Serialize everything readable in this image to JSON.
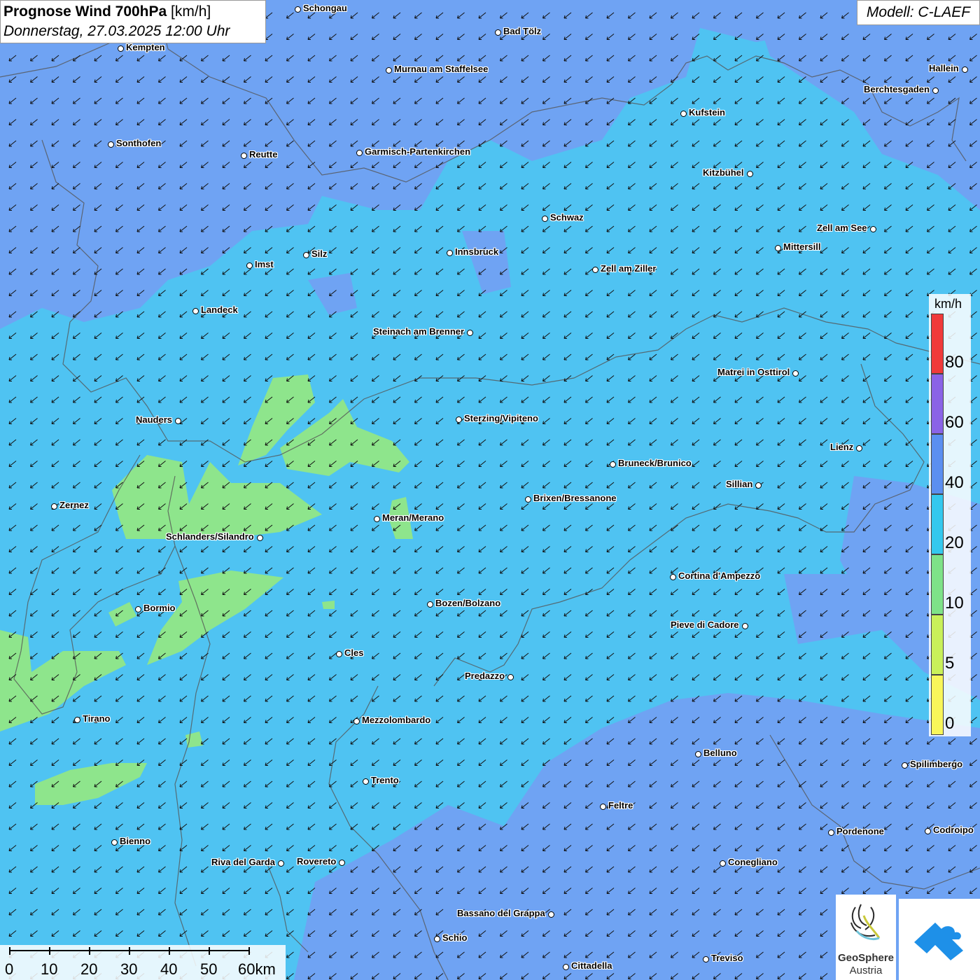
{
  "map": {
    "title_bold": "Prognose Wind 700hPa",
    "title_unit": "[km/h]",
    "subtitle": "Donnerstag, 27.03.2025 12:00 Uhr",
    "model": "Modell: C-LAEF"
  },
  "legend": {
    "unit": "km/h",
    "bins": [
      {
        "from": 0,
        "to": 5,
        "color": "#f8f65a"
      },
      {
        "from": 5,
        "to": 10,
        "color": "#c9f05a"
      },
      {
        "from": 10,
        "to": 20,
        "color": "#7ee288"
      },
      {
        "from": 20,
        "to": 40,
        "color": "#34c8ee"
      },
      {
        "from": 40,
        "to": 60,
        "color": "#5b8ff0"
      },
      {
        "from": 60,
        "to": 80,
        "color": "#8a63e6"
      },
      {
        "from": 80,
        "to": 100,
        "color": "#f03a3a"
      }
    ],
    "ticks": [
      "0",
      "5",
      "10",
      "20",
      "40",
      "60",
      "80"
    ]
  },
  "scale": {
    "labels": [
      "0",
      "10",
      "20",
      "30",
      "40",
      "50",
      "60km"
    ]
  },
  "wind": {
    "direction": "from northeast",
    "arrow_glyph": "↙"
  },
  "cities": [
    {
      "name": "Schongau"
    },
    {
      "name": "Bad Tölz"
    },
    {
      "name": "Kempten"
    },
    {
      "name": "Murnau am Staffelsee"
    },
    {
      "name": "Hallein"
    },
    {
      "name": "Berchtesgaden"
    },
    {
      "name": "Kufstein"
    },
    {
      "name": "Sonthofen"
    },
    {
      "name": "Reutte"
    },
    {
      "name": "Garmisch-Partenkirchen"
    },
    {
      "name": "Kitzbühel"
    },
    {
      "name": "Schwaz"
    },
    {
      "name": "Zell am See"
    },
    {
      "name": "Mittersill"
    },
    {
      "name": "Imst"
    },
    {
      "name": "Silz"
    },
    {
      "name": "Innsbruck"
    },
    {
      "name": "Zell am Ziller"
    },
    {
      "name": "Landeck"
    },
    {
      "name": "Steinach am Brenner"
    },
    {
      "name": "Matrei in Osttirol"
    },
    {
      "name": "Nauders"
    },
    {
      "name": "Sterzing/Vipiteno"
    },
    {
      "name": "Lienz"
    },
    {
      "name": "Bruneck/Brunico"
    },
    {
      "name": "Sillian"
    },
    {
      "name": "Zernez"
    },
    {
      "name": "Brixen/Bressanone"
    },
    {
      "name": "Meran/Merano"
    },
    {
      "name": "Schlanders/Silandro"
    },
    {
      "name": "Cortina d'Ampezzo"
    },
    {
      "name": "Bozen/Bolzano"
    },
    {
      "name": "Bormio"
    },
    {
      "name": "Pieve di Cadore"
    },
    {
      "name": "Cles"
    },
    {
      "name": "Predazzo"
    },
    {
      "name": "Tirano"
    },
    {
      "name": "Mezzolombardo"
    },
    {
      "name": "Belluno"
    },
    {
      "name": "Spilimbergo"
    },
    {
      "name": "Trento"
    },
    {
      "name": "Feltre"
    },
    {
      "name": "Pordenone"
    },
    {
      "name": "Codroipo"
    },
    {
      "name": "Bienno"
    },
    {
      "name": "Riva del Garda"
    },
    {
      "name": "Rovereto"
    },
    {
      "name": "Conegliano"
    },
    {
      "name": "Bassano del Grappa"
    },
    {
      "name": "Schio"
    },
    {
      "name": "Treviso"
    },
    {
      "name": "Cittadella"
    }
  ],
  "logo": {
    "name_line1": "GeoSphere",
    "name_line2": "Austria"
  }
}
